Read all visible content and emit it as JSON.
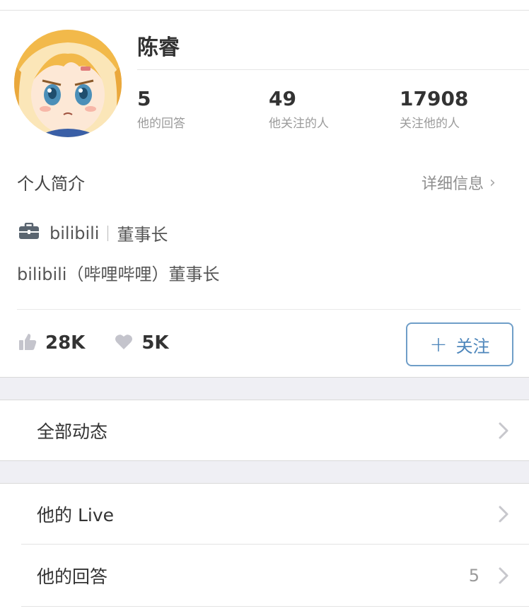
{
  "profile": {
    "name": "陈睿",
    "stats": [
      {
        "value": "5",
        "label": "他的回答"
      },
      {
        "value": "49",
        "label": "他关注的人"
      },
      {
        "value": "17908",
        "label": "关注他的人"
      }
    ]
  },
  "bio": {
    "title": "个人简介",
    "detail_label": "详细信息",
    "company": "bilibili",
    "position": "董事长",
    "description": "bilibili（哔哩哔哩）董事长"
  },
  "actions": {
    "likes": "28K",
    "thanks": "5K",
    "follow_label": "关注"
  },
  "menu": {
    "all_activity": "全部动态",
    "live": "他的 Live",
    "answers": "他的回答",
    "answers_count": "5"
  },
  "colors": {
    "accent": "#4d86bb",
    "band": "#efeff4",
    "muted_text": "#9b9b9b"
  },
  "icons": {
    "job": "briefcase-icon",
    "likes": "thumbs-up-icon",
    "thanks": "heart-icon",
    "row": "chevron-right-icon"
  }
}
